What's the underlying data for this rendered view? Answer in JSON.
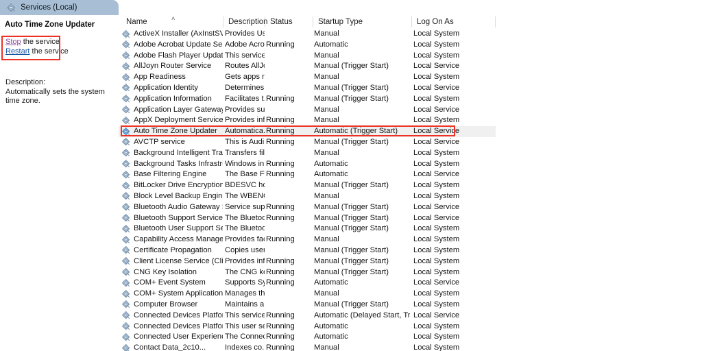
{
  "window": {
    "tab_label": "Services (Local)",
    "tab_icon": "service-gear-icon"
  },
  "details_pane": {
    "service_title": "Auto Time Zone Updater",
    "actions": [
      {
        "link": "Stop",
        "tail": " the service",
        "state": "visited"
      },
      {
        "link": "Restart",
        "tail": " the service",
        "state": "normal"
      }
    ],
    "description_label": "Description:",
    "description_text": "Automatically sets the system time zone."
  },
  "list": {
    "columns": [
      {
        "label": "Name",
        "sorted": true,
        "sort_caret": "˄"
      },
      {
        "label": "Description"
      },
      {
        "label": "Status"
      },
      {
        "label": "Startup Type"
      },
      {
        "label": "Log On As"
      }
    ],
    "selected_service": "Auto Time Zone Updater",
    "rows": [
      {
        "name": "ActiveX Installer (AxInstSV)",
        "description": "Provides Us...",
        "status": "",
        "startup": "Manual",
        "logon": "Local System"
      },
      {
        "name": "Adobe Acrobat Update Serv...",
        "description": "Adobe Acro...",
        "status": "Running",
        "startup": "Automatic",
        "logon": "Local System"
      },
      {
        "name": "Adobe Flash Player Update ...",
        "description": "This service ...",
        "status": "",
        "startup": "Manual",
        "logon": "Local System"
      },
      {
        "name": "AllJoyn Router Service",
        "description": "Routes AllJo...",
        "status": "",
        "startup": "Manual (Trigger Start)",
        "logon": "Local Service"
      },
      {
        "name": "App Readiness",
        "description": "Gets apps re...",
        "status": "",
        "startup": "Manual",
        "logon": "Local System"
      },
      {
        "name": "Application Identity",
        "description": "Determines ...",
        "status": "",
        "startup": "Manual (Trigger Start)",
        "logon": "Local Service"
      },
      {
        "name": "Application Information",
        "description": "Facilitates t...",
        "status": "Running",
        "startup": "Manual (Trigger Start)",
        "logon": "Local System"
      },
      {
        "name": "Application Layer Gateway ...",
        "description": "Provides su...",
        "status": "",
        "startup": "Manual",
        "logon": "Local Service"
      },
      {
        "name": "AppX Deployment Service (...",
        "description": "Provides inf...",
        "status": "Running",
        "startup": "Manual",
        "logon": "Local System"
      },
      {
        "name": "Auto Time Zone Updater",
        "description": "Automatica...",
        "status": "Running",
        "startup": "Automatic (Trigger Start)",
        "logon": "Local Service",
        "selected": true
      },
      {
        "name": "AVCTP service",
        "description": "This is Audi...",
        "status": "Running",
        "startup": "Manual (Trigger Start)",
        "logon": "Local Service"
      },
      {
        "name": "Background Intelligent Tran...",
        "description": "Transfers fil...",
        "status": "",
        "startup": "Manual",
        "logon": "Local System"
      },
      {
        "name": "Background Tasks Infrastru...",
        "description": "Windows in...",
        "status": "Running",
        "startup": "Automatic",
        "logon": "Local System"
      },
      {
        "name": "Base Filtering Engine",
        "description": "The Base Fil...",
        "status": "Running",
        "startup": "Automatic",
        "logon": "Local Service"
      },
      {
        "name": "BitLocker Drive Encryption ...",
        "description": "BDESVC hos...",
        "status": "",
        "startup": "Manual (Trigger Start)",
        "logon": "Local System"
      },
      {
        "name": "Block Level Backup Engine ...",
        "description": "The WBENG...",
        "status": "",
        "startup": "Manual",
        "logon": "Local System"
      },
      {
        "name": "Bluetooth Audio Gateway S...",
        "description": "Service sup...",
        "status": "Running",
        "startup": "Manual (Trigger Start)",
        "logon": "Local Service"
      },
      {
        "name": "Bluetooth Support Service",
        "description": "The Bluetoo...",
        "status": "Running",
        "startup": "Manual (Trigger Start)",
        "logon": "Local Service"
      },
      {
        "name": "Bluetooth User Support Ser...",
        "description": "The Bluetoo...",
        "status": "",
        "startup": "Manual (Trigger Start)",
        "logon": "Local System"
      },
      {
        "name": "Capability Access Manager ...",
        "description": "Provides fac...",
        "status": "Running",
        "startup": "Manual",
        "logon": "Local System"
      },
      {
        "name": "Certificate Propagation",
        "description": "Copies user ...",
        "status": "",
        "startup": "Manual (Trigger Start)",
        "logon": "Local System"
      },
      {
        "name": "Client License Service (ClipS...",
        "description": "Provides inf...",
        "status": "Running",
        "startup": "Manual (Trigger Start)",
        "logon": "Local System"
      },
      {
        "name": "CNG Key Isolation",
        "description": "The CNG ke...",
        "status": "Running",
        "startup": "Manual (Trigger Start)",
        "logon": "Local System"
      },
      {
        "name": "COM+ Event System",
        "description": "Supports Sy...",
        "status": "Running",
        "startup": "Automatic",
        "logon": "Local Service"
      },
      {
        "name": "COM+ System Application",
        "description": "Manages th...",
        "status": "",
        "startup": "Manual",
        "logon": "Local System"
      },
      {
        "name": "Computer Browser",
        "description": "Maintains a...",
        "status": "",
        "startup": "Manual (Trigger Start)",
        "logon": "Local System"
      },
      {
        "name": "Connected Devices Platfor...",
        "description": "This service ...",
        "status": "Running",
        "startup": "Automatic (Delayed Start, Tri...",
        "logon": "Local Service"
      },
      {
        "name": "Connected Devices Platfor...",
        "description": "This user se...",
        "status": "Running",
        "startup": "Automatic",
        "logon": "Local System"
      },
      {
        "name": "Connected User Experience...",
        "description": "The Connec...",
        "status": "Running",
        "startup": "Automatic",
        "logon": "Local System"
      },
      {
        "name": "Contact Data_2c10...",
        "description": "Indexes co...",
        "status": "Running",
        "startup": "Manual",
        "logon": "Local System"
      }
    ]
  },
  "annotations": {
    "highlight_color": "#ee3124",
    "boxes": [
      {
        "target": "service-action-links"
      },
      {
        "target": "auto-time-zone-updater-row"
      }
    ]
  }
}
